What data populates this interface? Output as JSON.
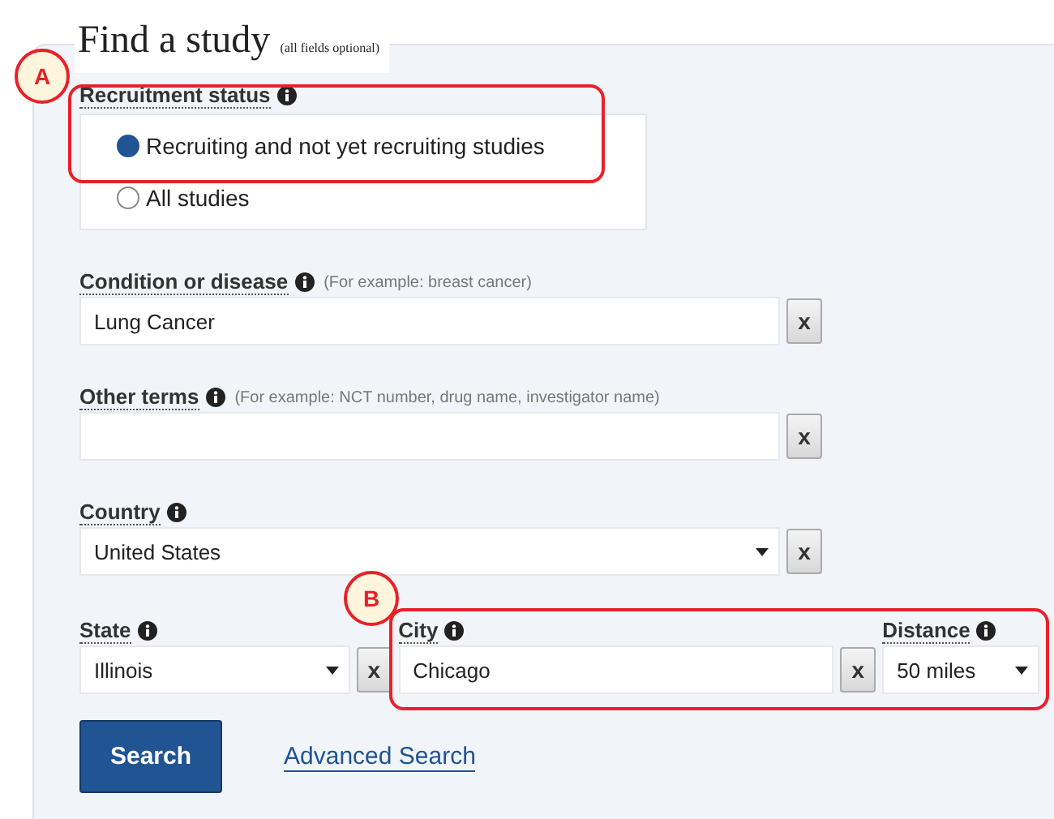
{
  "title": "Find a study",
  "subtitle": "(all fields optional)",
  "annotations": [
    {
      "label": "A"
    },
    {
      "label": "B"
    }
  ],
  "recruitment": {
    "label": "Recruitment status",
    "options": [
      {
        "label": "Recruiting and not yet recruiting studies",
        "selected": true
      },
      {
        "label": "All studies",
        "selected": false
      }
    ]
  },
  "fields": [
    {
      "kind": "text",
      "label": "Condition or disease",
      "hint": "(For example: breast cancer)",
      "value": "Lung Cancer",
      "clear": "x"
    },
    {
      "kind": "text",
      "label": "Other terms",
      "hint": "(For example: NCT number, drug name, investigator name)",
      "clear": "x"
    },
    {
      "kind": "select",
      "label": "Country",
      "value": "United States",
      "clear": "x"
    }
  ],
  "location": [
    {
      "kind": "select",
      "label": "State",
      "value": "Illinois",
      "clear": "x"
    },
    {
      "kind": "text",
      "label": "City",
      "value": "Chicago",
      "clear": "x"
    },
    {
      "kind": "select",
      "label": "Distance",
      "value": "50 miles"
    }
  ],
  "search_button": "Search",
  "advanced_link": "Advanced Search"
}
